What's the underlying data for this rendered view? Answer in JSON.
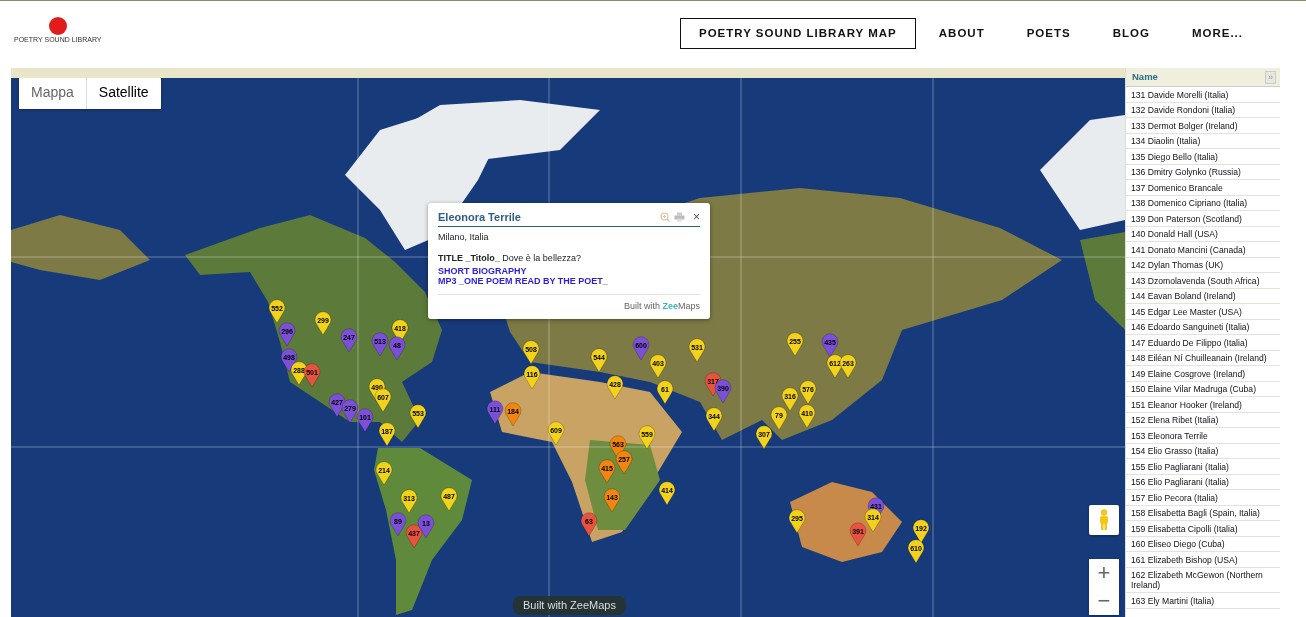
{
  "header": {
    "logo_text": "POETRY SOUND LIBRARY",
    "nav": [
      {
        "label": "POETRY SOUND LIBRARY MAP",
        "selected": true
      },
      {
        "label": "ABOUT",
        "selected": false
      },
      {
        "label": "POETS",
        "selected": false
      },
      {
        "label": "BLOG",
        "selected": false
      },
      {
        "label": "MORE...",
        "selected": false
      }
    ]
  },
  "map": {
    "types": [
      {
        "label": "Mappa",
        "selected": false
      },
      {
        "label": "Satellite",
        "selected": true
      }
    ],
    "zoom": [
      "+",
      "−"
    ],
    "credit": "Built with ZeeMaps",
    "pins": [
      {
        "label": "552",
        "color": "#f2d21a"
      },
      {
        "label": "299",
        "color": "#f2d21a"
      },
      {
        "label": "296",
        "color": "#7b4fd8"
      },
      {
        "label": "247",
        "color": "#7b4fd8"
      },
      {
        "label": "513",
        "color": "#7b4fd8"
      },
      {
        "label": "418",
        "color": "#f2d21a"
      },
      {
        "label": "48",
        "color": "#7b4fd8"
      },
      {
        "label": "498",
        "color": "#7b4fd8"
      },
      {
        "label": "288",
        "color": "#f2d21a"
      },
      {
        "label": "501",
        "color": "#e8533f"
      },
      {
        "label": "490",
        "color": "#f2d21a"
      },
      {
        "label": "607",
        "color": "#f2d21a"
      },
      {
        "label": "553",
        "color": "#f2d21a"
      },
      {
        "label": "427",
        "color": "#7b4fd8"
      },
      {
        "label": "279",
        "color": "#7b4fd8"
      },
      {
        "label": "101",
        "color": "#7b4fd8"
      },
      {
        "label": "187",
        "color": "#f2d21a"
      },
      {
        "label": "214",
        "color": "#f2d21a"
      },
      {
        "label": "313",
        "color": "#f2d21a"
      },
      {
        "label": "487",
        "color": "#f2d21a"
      },
      {
        "label": "89",
        "color": "#7b4fd8"
      },
      {
        "label": "437",
        "color": "#e8533f"
      },
      {
        "label": "13",
        "color": "#7b4fd8"
      },
      {
        "label": "111",
        "color": "#7b4fd8"
      },
      {
        "label": "184",
        "color": "#f0850f"
      },
      {
        "label": "609",
        "color": "#f2d21a"
      },
      {
        "label": "559",
        "color": "#f2d21a"
      },
      {
        "label": "563",
        "color": "#f0850f"
      },
      {
        "label": "257",
        "color": "#f0850f"
      },
      {
        "label": "415",
        "color": "#f0850f"
      },
      {
        "label": "414",
        "color": "#f2d21a"
      },
      {
        "label": "143",
        "color": "#f0850f"
      },
      {
        "label": "63",
        "color": "#e8533f"
      },
      {
        "label": "508",
        "color": "#f2d21a"
      },
      {
        "label": "116",
        "color": "#f2d21a"
      },
      {
        "label": "544",
        "color": "#f2d21a"
      },
      {
        "label": "600",
        "color": "#7b4fd8"
      },
      {
        "label": "403",
        "color": "#f2d21a"
      },
      {
        "label": "428",
        "color": "#f2d21a"
      },
      {
        "label": "61",
        "color": "#f2d21a"
      },
      {
        "label": "531",
        "color": "#f2d21a"
      },
      {
        "label": "255",
        "color": "#f2d21a"
      },
      {
        "label": "435",
        "color": "#7b4fd8"
      },
      {
        "label": "612",
        "color": "#f2d21a"
      },
      {
        "label": "263",
        "color": "#f2d21a"
      },
      {
        "label": "317",
        "color": "#e8533f"
      },
      {
        "label": "390",
        "color": "#7b4fd8"
      },
      {
        "label": "576",
        "color": "#f2d21a"
      },
      {
        "label": "316",
        "color": "#f2d21a"
      },
      {
        "label": "344",
        "color": "#f2d21a"
      },
      {
        "label": "79",
        "color": "#f2d21a"
      },
      {
        "label": "410",
        "color": "#f2d21a"
      },
      {
        "label": "307",
        "color": "#f2d21a"
      },
      {
        "label": "295",
        "color": "#f2d21a"
      },
      {
        "label": "431",
        "color": "#7b4fd8"
      },
      {
        "label": "314",
        "color": "#f2d21a"
      },
      {
        "label": "391",
        "color": "#e8533f"
      },
      {
        "label": "192",
        "color": "#f2d21a"
      },
      {
        "label": "610",
        "color": "#f2d21a"
      }
    ],
    "popup": {
      "title": "Eleonora Terrile",
      "location": "Milano, Italia",
      "description": "**TITLE _Titolo_** Dove è la bellezza?",
      "links": [
        "SHORT BIOGRAPHY",
        "MP3 _ONE POEM READ BY THE POET_"
      ],
      "close": "×",
      "footer": {
        "text": "Built with",
        "brand_first": "Zee",
        "brand_second": "Maps"
      }
    }
  },
  "list": {
    "header": "Name",
    "toggle": "»",
    "rows": [
      "131 Davide Morelli (Italia)",
      "132 Davide Rondoni (Italia)",
      "133 Dermot Bolger (Ireland)",
      "134 Diaolin (Italia)",
      "135 Diego Bello (Italia)",
      "136 Dmitry Golynko (Russia)",
      "137 Domenico Brancale",
      "138 Domenico Cipriano (Italia)",
      "139 Don Paterson (Scotland)",
      "140 Donald Hall (USA)",
      "141 Donato Mancini (Canada)",
      "142 Dylan Thomas (UK)",
      "143 Dzomolavenda (South Africa)",
      "144 Eavan Boland (Ireland)",
      "145 Edgar Lee Master (USA)",
      "146 Edoardo Sanguineti (Italia)",
      "147 Eduardo De Filippo (Italia)",
      "148 Eiléan Ní Chuilleanain (Ireland)",
      "149 Elaine Cosgrove (Ireland)",
      "150 Elaine Vilar Madruga (Cuba)",
      "151 Eleanor Hooker (Ireland)",
      "152 Elena Ribet (Italia)",
      "153 Eleonora Terrile",
      "154 Elio Grasso (Italia)",
      "155 Elio Pagliarani (Italia)",
      "156 Elio Pagliarani (Italia)",
      "157 Elio Pecora (Italia)",
      "158 Elisabetta Bagli (Spain, Italia)",
      "159 Elisabetta Cipolli (Italia)",
      "160 Eliseo Diego (Cuba)",
      "161 Elizabeth Bishop (USA)",
      "162 Elizabeth McGewon (Northern Ireland)",
      "163 Ely Martini (Italia)"
    ]
  }
}
